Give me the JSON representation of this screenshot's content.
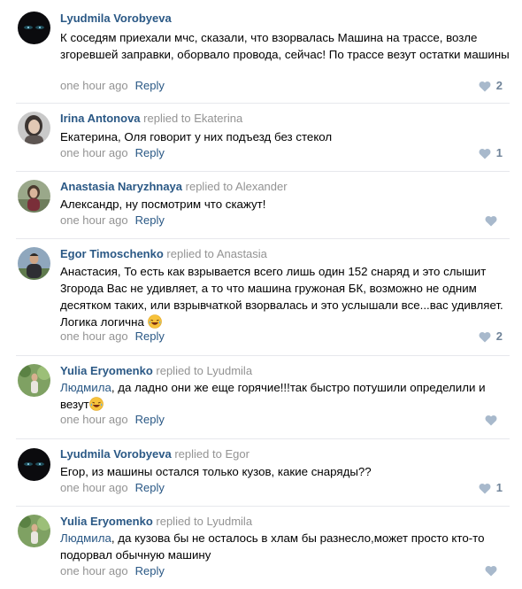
{
  "comments": [
    {
      "author": "Lyudmila Vorobyeva",
      "replied_text": "",
      "target": "",
      "mention": "",
      "text": "К соседям приехали мчс, сказали, что взорвалась Машина на трассе, возле згоревшей заправки, оборвало провода, сейчас! По трассе везут остатки машины",
      "time": "one hour ago",
      "reply": "Reply",
      "likes": "2",
      "avatar": "dark-avatar"
    },
    {
      "author": "Irina Antonova",
      "replied_text": "replied to",
      "target": "Ekaterina",
      "mention": "",
      "text": "Екатерина, Оля говорит у них подъезд без стекол",
      "time": "one hour ago",
      "reply": "Reply",
      "likes": "1",
      "avatar": "woman-portrait-avatar"
    },
    {
      "author": "Anastasia Naryzhnaya",
      "replied_text": "replied to",
      "target": "Alexander",
      "mention": "",
      "text": "Александр, ну посмотрим что скажут!",
      "time": "one hour ago",
      "reply": "Reply",
      "likes": "",
      "avatar": "woman-outdoor-avatar"
    },
    {
      "author": "Egor Timoschenko",
      "replied_text": "replied to",
      "target": "Anastasia",
      "mention": "",
      "text": "Анастасия, То есть как взрывается всего лишь один 152 снаряд и это слышит 3города Вас не удивляет, а то что машина гружоная БК, возможно не одним десятком таких, или взрывчаткой взорвалась и это услышали все...вас удивляет. Логика логична",
      "emoji": "laughing-emoji",
      "time": "one hour ago",
      "reply": "Reply",
      "likes": "2",
      "avatar": "man-outdoor-avatar"
    },
    {
      "author": "Yulia Eryomenko",
      "replied_text": "replied to",
      "target": "Lyudmila",
      "mention": "Людмила",
      "text": ", да ладно они же еще горячие!!!так быстро потушили определили и везут",
      "emoji": "laughing-emoji",
      "time": "one hour ago",
      "reply": "Reply",
      "likes": "",
      "avatar": "woman-green-avatar"
    },
    {
      "author": "Lyudmila Vorobyeva",
      "replied_text": "replied to",
      "target": "Egor",
      "mention": "",
      "text": "Егор, из машины остался только кузов, какие снаряды??",
      "time": "one hour ago",
      "reply": "Reply",
      "likes": "1",
      "avatar": "dark-avatar"
    },
    {
      "author": "Yulia Eryomenko",
      "replied_text": "replied to",
      "target": "Lyudmila",
      "mention": "Людмила",
      "text": ", да кузова бы не осталось в хлам бы разнесло,может просто кто-то подорвал обычную машину",
      "time": "one hour ago",
      "reply": "Reply",
      "likes": "",
      "avatar": "woman-green-avatar"
    }
  ],
  "colors": {
    "link": "#2a5885",
    "muted": "#939393",
    "like_icon": "#a8b9cc",
    "divider": "#e7e8ec"
  }
}
